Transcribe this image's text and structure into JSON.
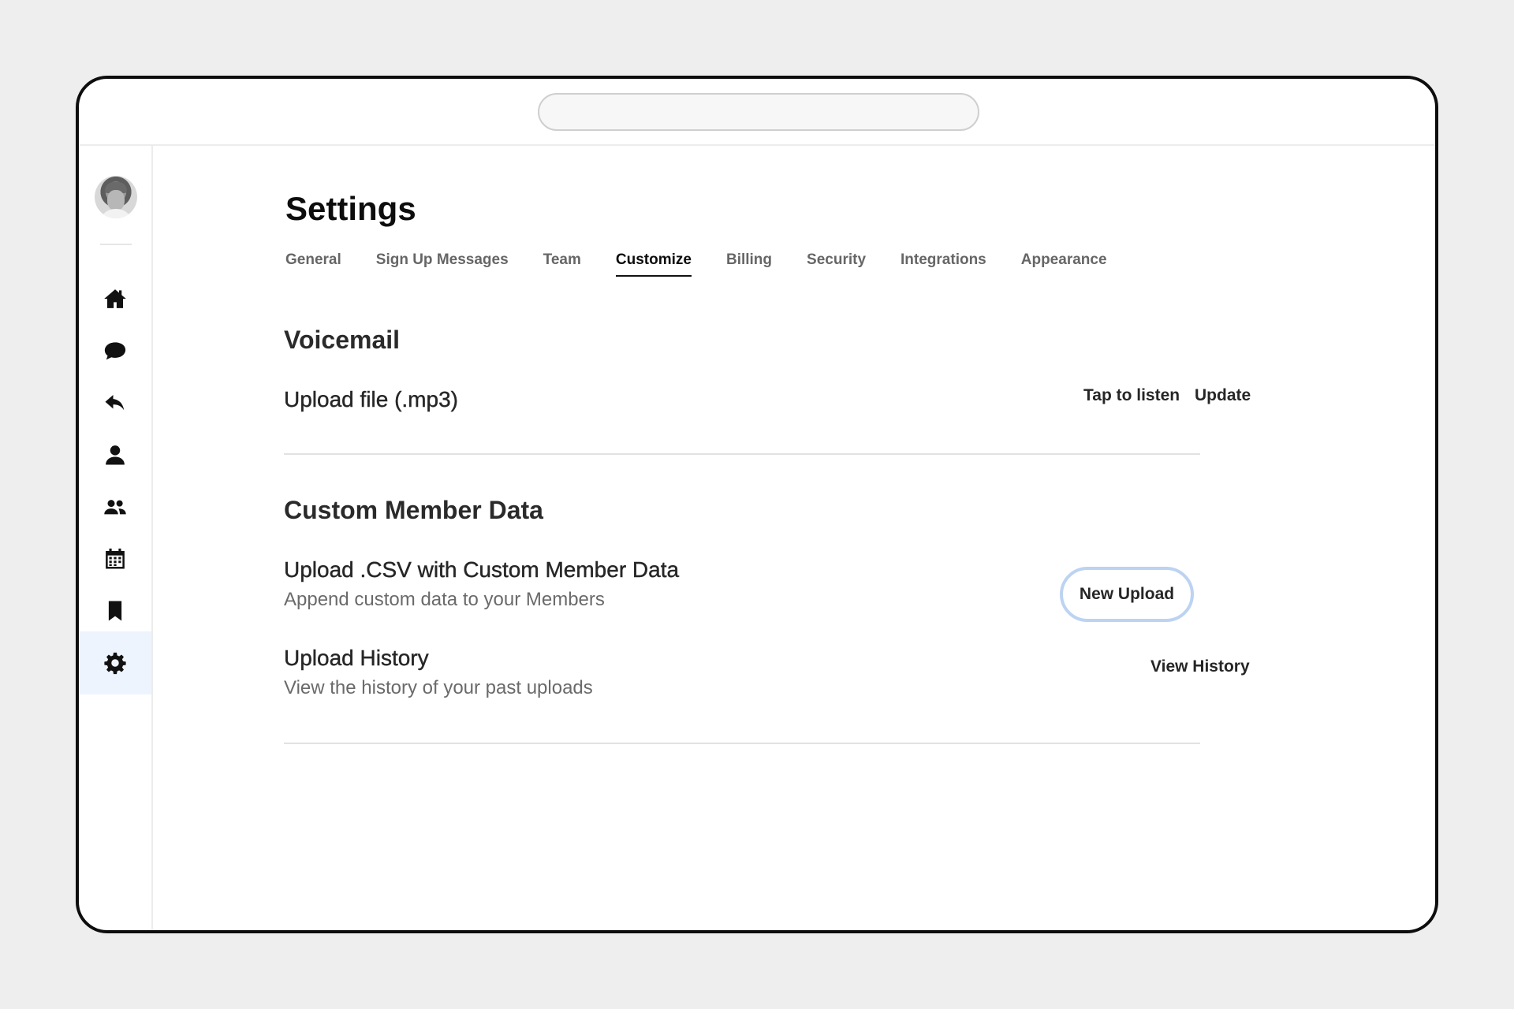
{
  "page": {
    "title": "Settings"
  },
  "tabs": [
    {
      "label": "General"
    },
    {
      "label": "Sign Up Messages"
    },
    {
      "label": "Team"
    },
    {
      "label": "Customize"
    },
    {
      "label": "Billing"
    },
    {
      "label": "Security"
    },
    {
      "label": "Integrations"
    },
    {
      "label": "Appearance"
    }
  ],
  "active_tab": "Customize",
  "sidebar": {
    "items": [
      {
        "icon": "home-icon"
      },
      {
        "icon": "chat-bubble-icon"
      },
      {
        "icon": "reply-icon"
      },
      {
        "icon": "person-icon"
      },
      {
        "icon": "group-icon"
      },
      {
        "icon": "calendar-icon"
      },
      {
        "icon": "bookmark-icon"
      },
      {
        "icon": "gear-icon",
        "active": true
      }
    ]
  },
  "voicemail": {
    "title": "Voicemail",
    "upload_label": "Upload file (.mp3)",
    "listen_label": "Tap to listen",
    "update_label": "Update"
  },
  "custom_member_data": {
    "title": "Custom Member Data",
    "upload_csv_title": "Upload .CSV with Custom Member Data",
    "upload_csv_subtitle": "Append custom data to your Members",
    "new_upload_label": "New Upload",
    "history_title": "Upload History",
    "history_subtitle": "View the history of your past uploads",
    "view_history_label": "View History"
  },
  "colors": {
    "active_nav_bg": "#eef4fd",
    "button_outline": "#bcd3f2"
  }
}
